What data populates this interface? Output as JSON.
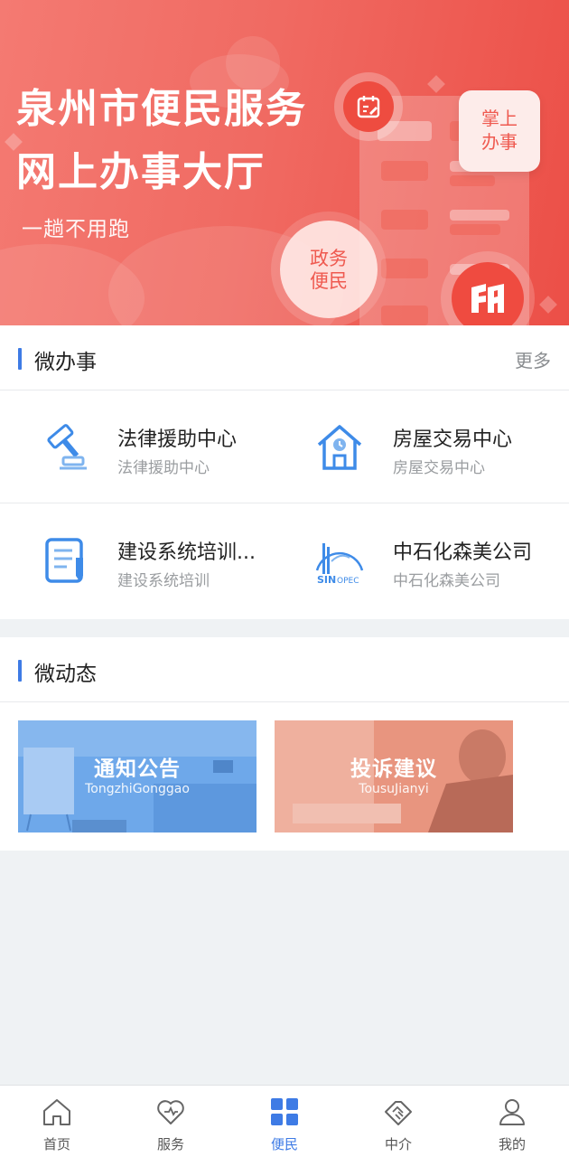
{
  "banner": {
    "title_line1": "泉州市便民服务",
    "title_line2": "网上办事大厅",
    "slogan": "一趟不用跑",
    "badge_card": [
      "掌上",
      "办事"
    ],
    "gov_circle": [
      "政务",
      "便民"
    ],
    "colors": {
      "gradient_start": "#f47a72",
      "gradient_end": "#ec4f47"
    }
  },
  "services_section": {
    "title": "微办事",
    "more_label": "更多",
    "items": [
      {
        "name": "法律援助中心",
        "sub": "法律援助中心",
        "icon": "gavel-icon"
      },
      {
        "name": "房屋交易中心",
        "sub": "房屋交易中心",
        "icon": "house-clock-icon"
      },
      {
        "name": "建设系统培训...",
        "sub": "建设系统培训",
        "icon": "document-edit-icon"
      },
      {
        "name": "中石化森美公司",
        "sub": "中石化森美公司",
        "icon": "sinopec-logo-icon"
      }
    ]
  },
  "news_section": {
    "title": "微动态",
    "cards": [
      {
        "title": "通知公告",
        "subtitle": "TongzhiGonggao",
        "color": "#6aa6e8"
      },
      {
        "title": "投诉建议",
        "subtitle": "TousuJianyi",
        "color": "#e48c7a"
      }
    ]
  },
  "tabbar": {
    "active_index": 2,
    "accent_color": "#3e7be5",
    "tabs": [
      {
        "label": "首页",
        "icon": "home-icon"
      },
      {
        "label": "服务",
        "icon": "heart-icon"
      },
      {
        "label": "便民",
        "icon": "grid-icon"
      },
      {
        "label": "中介",
        "icon": "handshake-icon"
      },
      {
        "label": "我的",
        "icon": "user-icon"
      }
    ]
  }
}
